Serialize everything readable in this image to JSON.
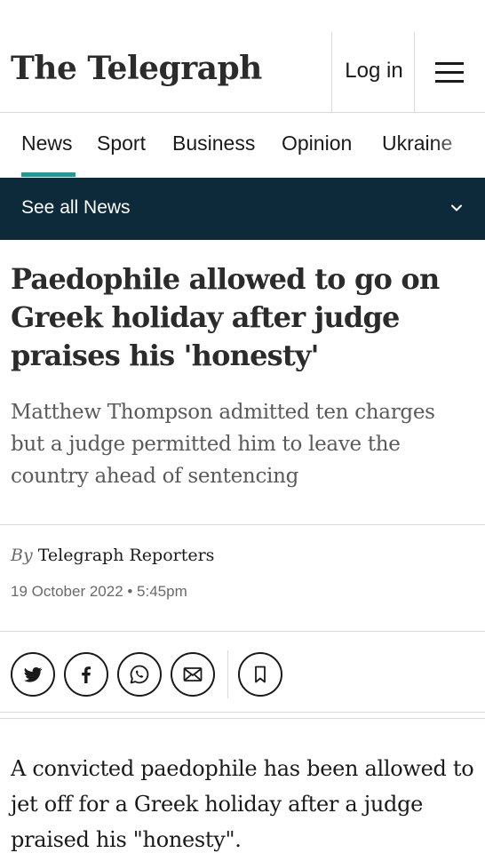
{
  "header": {
    "logo_text": "The Telegraph",
    "login_label": "Log in",
    "menu_icon": "hamburger-menu-icon"
  },
  "nav": {
    "items": [
      {
        "label": "News",
        "active": true
      },
      {
        "label": "Sport",
        "active": false
      },
      {
        "label": "Business",
        "active": false
      },
      {
        "label": "Opinion",
        "active": false
      },
      {
        "label": "Ukraine",
        "active": false
      }
    ],
    "accent_color": "#1b9c94"
  },
  "see_all": {
    "label": "See all News",
    "icon": "chevron-down-icon",
    "background_color": "#0c2a3a"
  },
  "article": {
    "headline": "Paedophile allowed to go on Greek holiday after judge praises his 'honesty'",
    "standfirst": "Matthew Thompson admitted ten charges but a judge permitted him to leave the country ahead of sentencing",
    "byline_prefix": "By",
    "author": "Telegraph Reporters",
    "date": "19 October 2022 • 5:45pm",
    "body_first_para": "A convicted paedophile has been allowed to jet off for a Greek holiday after a judge praised his \"honesty\"."
  },
  "share": {
    "icons": [
      "twitter-icon",
      "facebook-icon",
      "whatsapp-icon",
      "email-icon",
      "bookmark-icon"
    ]
  }
}
